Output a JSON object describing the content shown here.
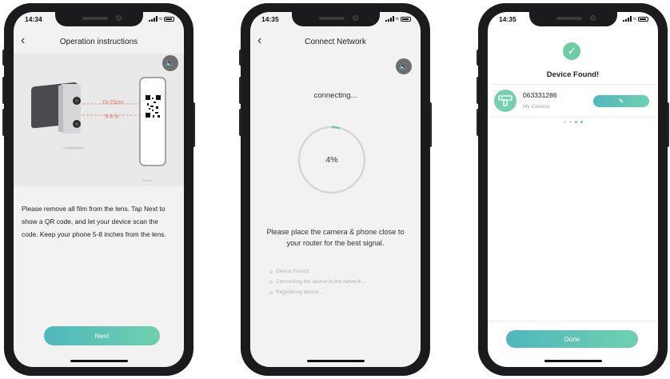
{
  "phone1": {
    "time": "14:34",
    "title": "Operation instructions",
    "back_icon": "chevron-left-icon",
    "sound_icon": "speaker-icon",
    "illustration": {
      "distance_cm": "15-25cm",
      "distance_in": "5-8 in"
    },
    "instructions": "Please remove all film from the lens. Tap Next to show a QR code, and let your device scan the code. Keep your phone 5-8 inches from the lens.",
    "next_label": "Next"
  },
  "phone2": {
    "time": "14:35",
    "title": "Connect Network",
    "status": "connecting...",
    "progress_label": "4%",
    "progress_value": 0.04,
    "instruction": "Please place the camera & phone close to your router for the best signal.",
    "steps": [
      "Device Found!",
      "Connecting the device to the network...",
      "Registering device..."
    ]
  },
  "phone3": {
    "time": "14:35",
    "title": "Device Found!",
    "device": {
      "id": "063331286",
      "name": "My Camera"
    },
    "edit_icon": "pencil-icon",
    "done_label": "Done"
  },
  "colors": {
    "accent_start": "#4fb7bd",
    "accent_end": "#6fd0ae",
    "success": "#6ccda5",
    "frame": "#1b1b1d"
  }
}
